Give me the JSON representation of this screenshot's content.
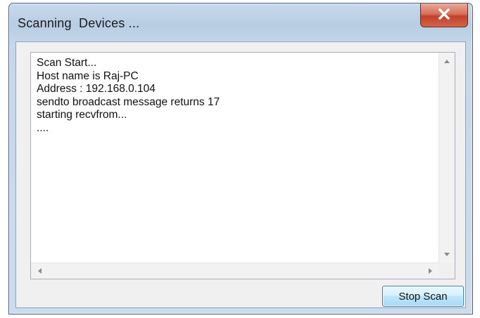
{
  "window": {
    "title": "Scanning  Devices ..."
  },
  "log": {
    "text": "Scan Start...\nHost name is Raj-PC\nAddress : 192.168.0.104\nsendto broadcast message returns 17\nstarting recvfrom...\n...."
  },
  "buttons": {
    "stop_scan_label": "Stop Scan",
    "close_icon": "close-x-icon"
  },
  "colors": {
    "close_button": "#c4412a",
    "title_bar": "#b8cde3",
    "button_border": "#3c7fb1"
  }
}
